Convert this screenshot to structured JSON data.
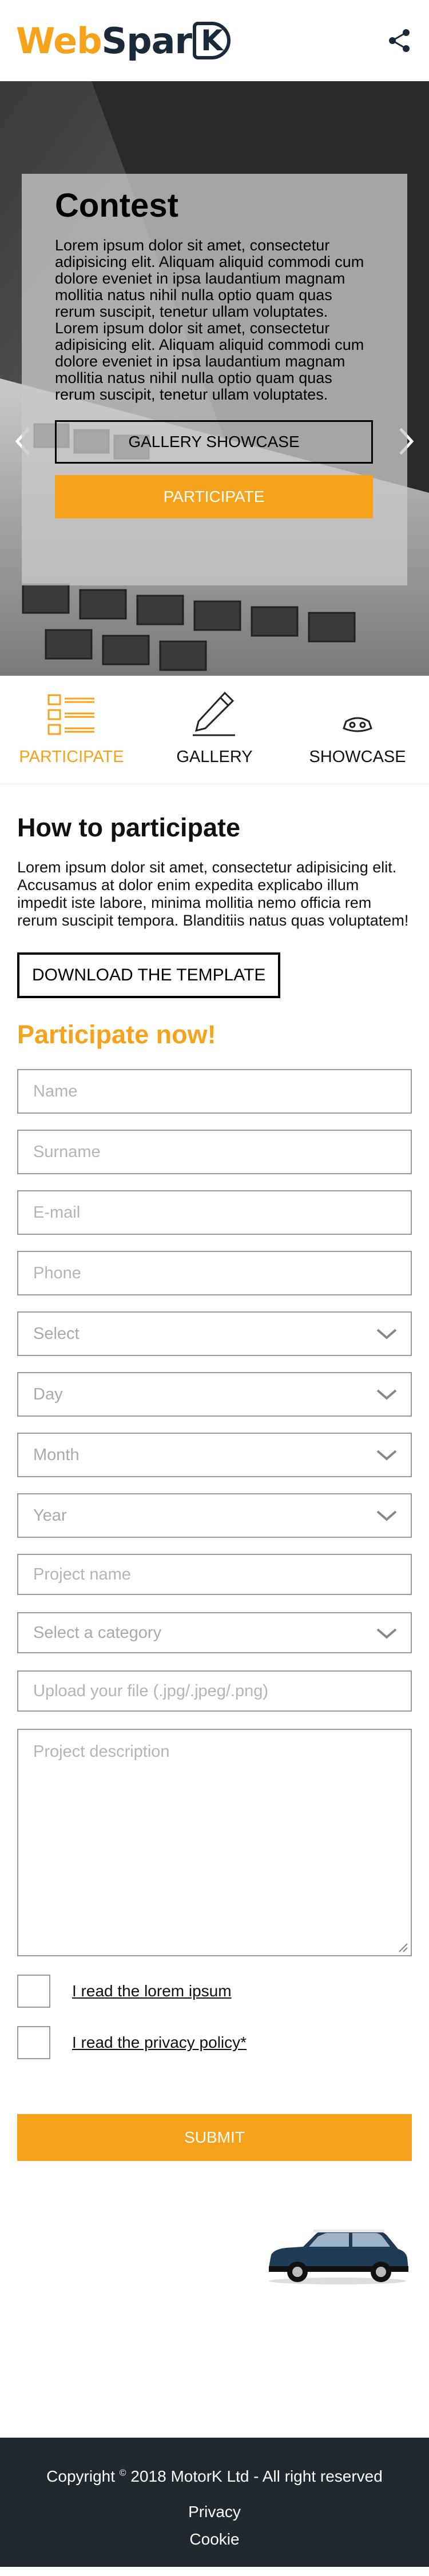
{
  "header": {
    "logo_web": "Web",
    "logo_spar": "Spar",
    "logo_k": "K",
    "share_icon": "share-icon"
  },
  "hero": {
    "title": "Contest",
    "paragraph_1": "Lorem ipsum dolor sit amet, consectetur adipisicing elit. Aliquam aliquid commodi cum dolore eveniet in ipsa laudantium magnam mollitia natus nihil nulla optio quam quas rerum suscipit, tenetur ullam voluptates.",
    "paragraph_2": "Lorem ipsum dolor sit amet, consectetur adipisicing elit. Aliquam aliquid commodi cum dolore eveniet in ipsa laudantium magnam mollitia natus nihil nulla optio quam quas rerum suscipit, tenetur ullam voluptates.",
    "gallery_button": "GALLERY SHOWCASE",
    "participate_button": "PARTICIPATE"
  },
  "tabs": [
    {
      "label": "PARTICIPATE",
      "icon": "list-icon",
      "active": true
    },
    {
      "label": "GALLERY",
      "icon": "pencil-icon",
      "active": false
    },
    {
      "label": "SHOWCASE",
      "icon": "mask-icon",
      "active": false
    }
  ],
  "how": {
    "title": "How to participate",
    "text": "Lorem ipsum dolor sit amet, consectetur adipisicing elit. Accusamus at dolor enim expedita explicabo illum impedit iste labore, minima mollitia nemo officia rem rerum suscipit tempora. Blanditiis natus quas voluptatem!",
    "download_button": "DOWNLOAD THE TEMPLATE"
  },
  "form": {
    "title": "Participate now!",
    "name_placeholder": "Name",
    "surname_placeholder": "Surname",
    "email_placeholder": "E-mail",
    "phone_placeholder": "Phone",
    "select_value": "Select",
    "day_value": "Day",
    "month_value": "Month",
    "year_value": "Year",
    "project_name_placeholder": "Project name",
    "category_value": "Select a category",
    "upload_placeholder": "Upload your file (.jpg/.jpeg/.png)",
    "description_placeholder": "Project description",
    "check_1": "I read the lorem ipsum",
    "check_2": "I read the privacy policy*",
    "submit": "SUBMIT"
  },
  "footer": {
    "copyright_prefix": "Copyright",
    "copyright_symbol": "©",
    "copyright_text": "2018 MotorK Ltd - All right reserved",
    "privacy": "Privacy",
    "cookie": "Cookie"
  },
  "colors": {
    "accent": "#f7a21b",
    "dark": "#222830",
    "logo_dark": "#1a2a3a"
  }
}
